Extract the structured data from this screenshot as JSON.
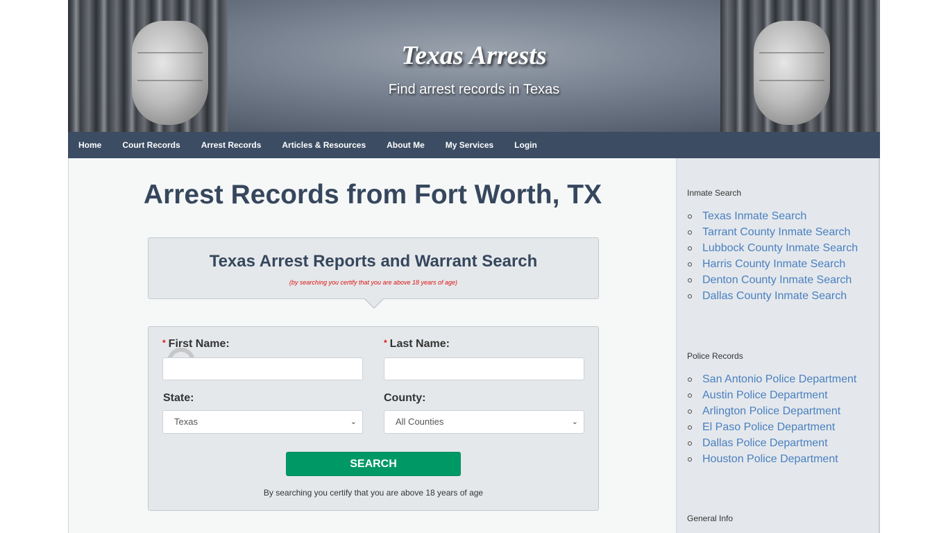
{
  "header": {
    "site_title": "Texas Arrests",
    "tagline": "Find arrest records in Texas"
  },
  "nav": {
    "items": [
      {
        "label": "Home"
      },
      {
        "label": "Court Records"
      },
      {
        "label": "Arrest Records"
      },
      {
        "label": "Articles & Resources"
      },
      {
        "label": "About Me"
      },
      {
        "label": "My Services"
      },
      {
        "label": "Login"
      }
    ]
  },
  "main": {
    "page_title": "Arrest Records from Fort Worth, TX",
    "search_box": {
      "heading": "Texas Arrest Reports and Warrant Search",
      "note": "(by searching you certify that you are above 18 years of age)"
    },
    "form": {
      "required_mark": "*",
      "first_name_label": "First Name:",
      "first_name_value": "",
      "last_name_label": "Last Name:",
      "last_name_value": "",
      "state_label": "State:",
      "state_selected": "Texas",
      "county_label": "County:",
      "county_selected": "All Counties",
      "search_button": "SEARCH",
      "footer_note": "By searching you certify that you are above 18 years of age",
      "button_color": "#009966"
    }
  },
  "sidebar": {
    "sections": [
      {
        "heading": "Inmate Search",
        "links": [
          "Texas Inmate Search",
          "Tarrant County Inmate Search",
          "Lubbock County Inmate Search",
          "Harris County Inmate Search",
          "Denton County Inmate Search",
          "Dallas County Inmate Search"
        ]
      },
      {
        "heading": "Police Records",
        "links": [
          "San Antonio Police Department",
          "Austin Police Department",
          "Arlington Police Department",
          "El Paso Police Department",
          "Dallas Police Department",
          "Houston Police Department"
        ]
      },
      {
        "heading": "General Info",
        "links": []
      }
    ]
  },
  "colors": {
    "nav_bg": "#3b4c63",
    "title_text": "#36475d",
    "link": "#4a7fc0",
    "warning_text": "#dd1111"
  }
}
